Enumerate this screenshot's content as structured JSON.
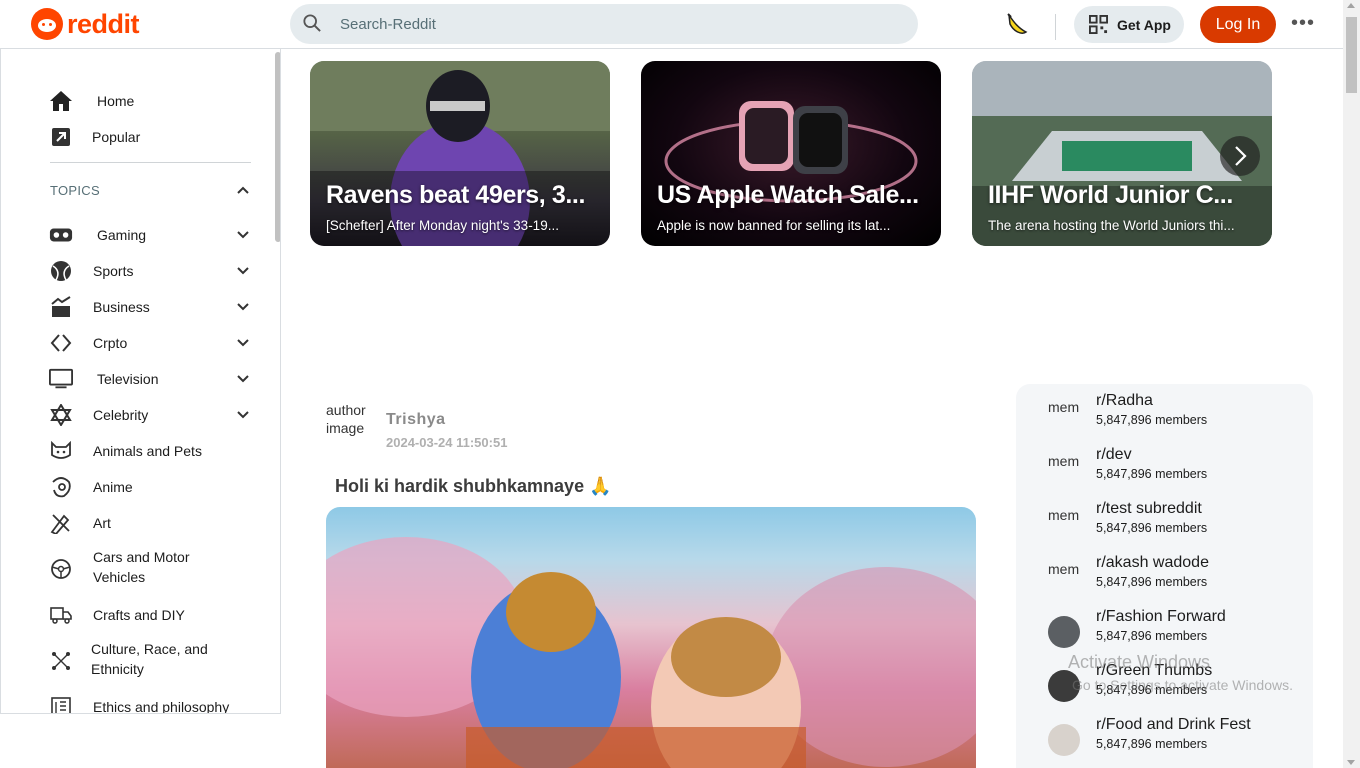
{
  "header": {
    "logo_text": "reddit",
    "search_placeholder": "Search-Reddit",
    "get_app_label": "Get App",
    "login_label": "Log In",
    "more_label": "•••"
  },
  "sidebar": {
    "home": "Home",
    "popular": "Popular",
    "topics_label": "TOPICS",
    "topics": [
      {
        "label": "Gaming",
        "icon": "gamepad-icon"
      },
      {
        "label": "Sports",
        "icon": "ball-icon"
      },
      {
        "label": "Business",
        "icon": "business-icon"
      },
      {
        "label": "Crpto",
        "icon": "crypto-icon"
      },
      {
        "label": "Television",
        "icon": "tv-icon"
      },
      {
        "label": "Celebrity",
        "icon": "star-icon"
      },
      {
        "label": "Animals and Pets",
        "icon": "cat-icon"
      },
      {
        "label": "Anime",
        "icon": "anime-icon"
      },
      {
        "label": "Art",
        "icon": "art-icon"
      },
      {
        "label": "Cars and Motor Vehicles",
        "icon": "steering-wheel-icon"
      },
      {
        "label": "Crafts and DIY",
        "icon": "truck-icon"
      },
      {
        "label": "Culture, Race, and Ethnicity",
        "icon": "culture-icon"
      },
      {
        "label": "Ethics and philosophy",
        "icon": "book-icon"
      }
    ]
  },
  "carousel": [
    {
      "title": "Ravens beat 49ers, 3...",
      "subtitle": "[Schefter] After Monday night's 33-19..."
    },
    {
      "title": "US Apple Watch Sale...",
      "subtitle": "Apple is now banned for selling its lat..."
    },
    {
      "title": "IIHF World Junior C...",
      "subtitle": "The arena hosting the World Juniors thi..."
    }
  ],
  "post": {
    "avatar_alt": "author image",
    "author": "Trishya",
    "timestamp": "2024-03-24 11:50:51",
    "title": "Holi ki hardik shubhkamnaye 🙏"
  },
  "communities": [
    {
      "name": "r/Radha",
      "members": "5,847,896 members",
      "avatar_alt": "member"
    },
    {
      "name": "r/dev",
      "members": "5,847,896 members",
      "avatar_alt": "member"
    },
    {
      "name": "r/test subreddit",
      "members": "5,847,896 members",
      "avatar_alt": "member"
    },
    {
      "name": "r/akash wadode",
      "members": "5,847,896 members",
      "avatar_alt": "member"
    },
    {
      "name": "r/Fashion Forward",
      "members": "5,847,896 members",
      "avatar_alt": ""
    },
    {
      "name": "r/Green Thumbs",
      "members": "5,847,896 members",
      "avatar_alt": ""
    },
    {
      "name": "r/Food and Drink Fest",
      "members": "5,847,896 members",
      "avatar_alt": ""
    }
  ],
  "watermark": {
    "line1": "Activate Windows",
    "line2": "Go to Settings to activate Windows."
  },
  "colors": {
    "brand": "#ff4500",
    "login": "#d93a00",
    "search_bg": "#e5ebee"
  }
}
